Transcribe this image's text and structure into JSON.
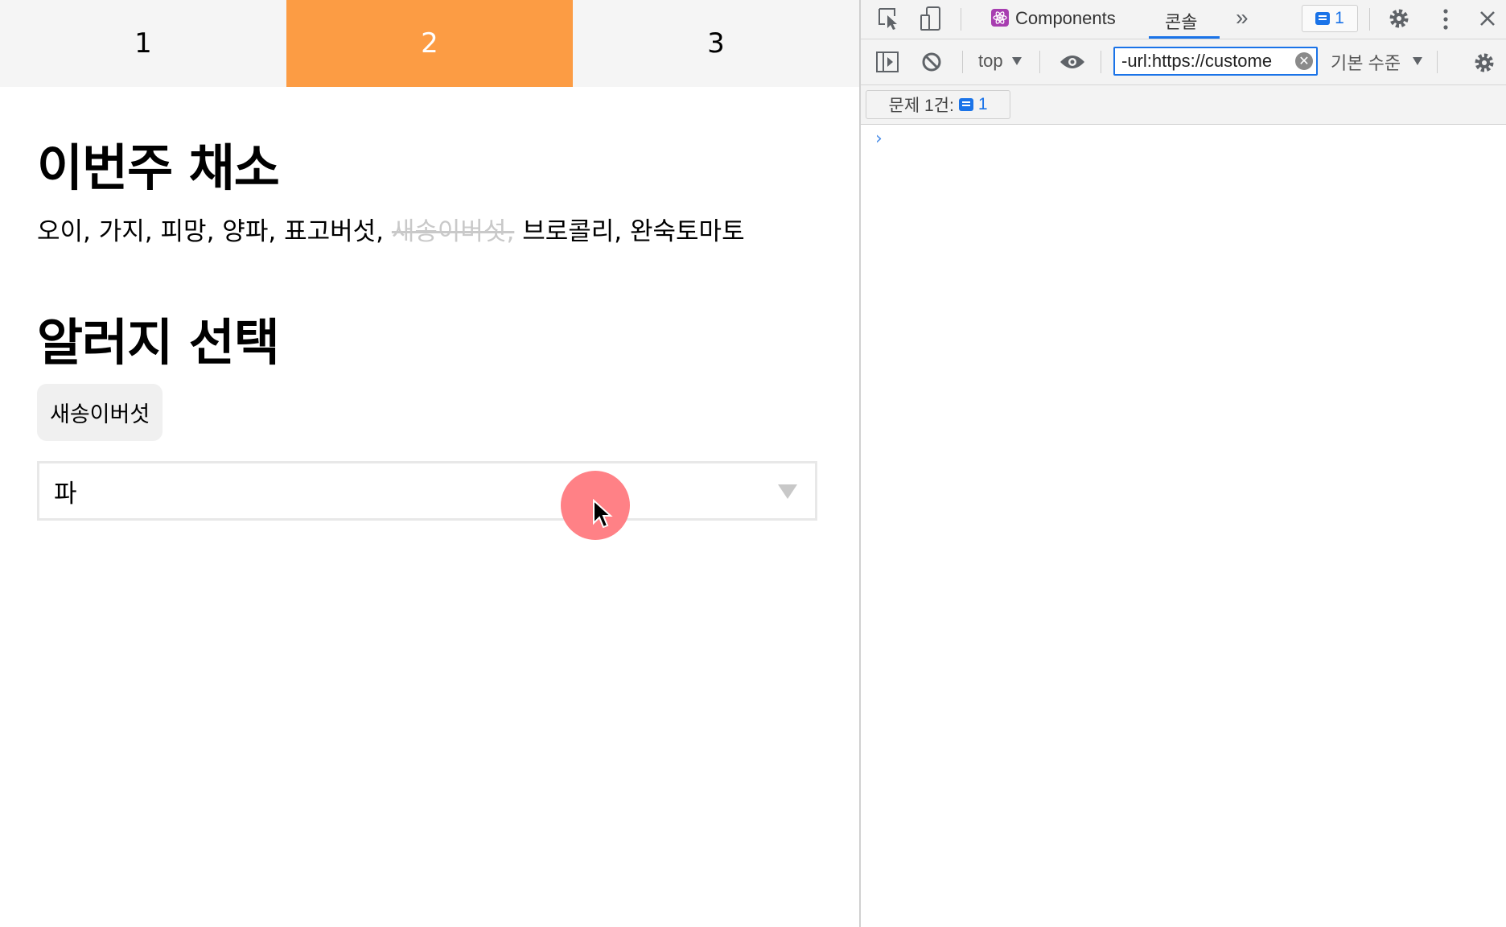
{
  "app": {
    "tabs": [
      {
        "label": "1",
        "active": false
      },
      {
        "label": "2",
        "active": true
      },
      {
        "label": "3",
        "active": false
      }
    ],
    "vegetables_heading": "이번주 채소",
    "vegetables": [
      {
        "name": "오이",
        "excluded": false
      },
      {
        "name": "가지",
        "excluded": false
      },
      {
        "name": "피망",
        "excluded": false
      },
      {
        "name": "양파",
        "excluded": false
      },
      {
        "name": "표고버섯",
        "excluded": false
      },
      {
        "name": "새송이버섯",
        "excluded": true
      },
      {
        "name": "브로콜리",
        "excluded": false
      },
      {
        "name": "완숙토마토",
        "excluded": false
      }
    ],
    "allergy_heading": "알러지 선택",
    "selected_allergy_chip": "새송이버섯",
    "select_value": "파"
  },
  "devtools": {
    "tabs": {
      "components": "Components",
      "console": "콘솔",
      "more": "»"
    },
    "message_count": "1",
    "context": "top",
    "filter_value": "-url:https://custome",
    "level": "기본 수준",
    "issues_label": "문제 1건:",
    "issues_count": "1",
    "prompt_symbol": "›"
  },
  "colors": {
    "active_tab": "#fc9c44",
    "cursor_highlight": "#ff8186",
    "devtools_accent": "#1a73e8"
  }
}
